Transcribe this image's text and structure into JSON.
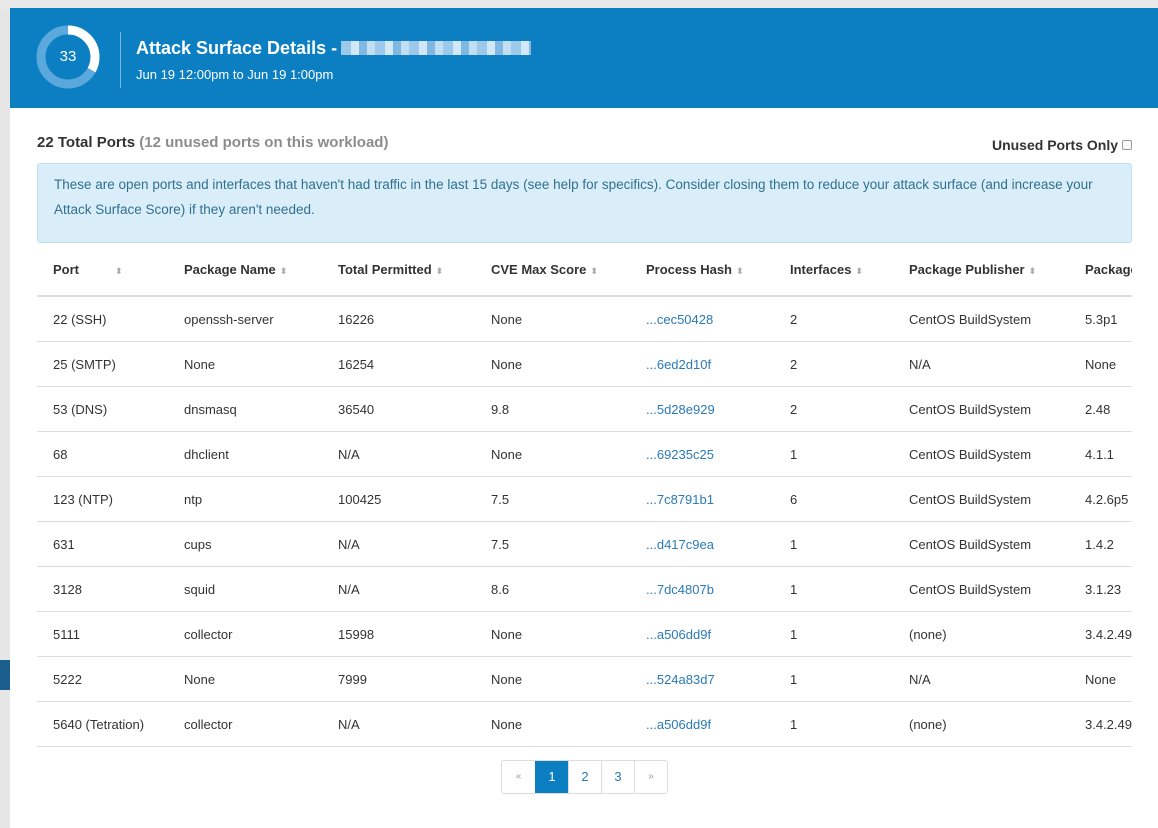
{
  "header": {
    "score": "33",
    "score_fraction": 0.33,
    "title": "Attack Surface Details -",
    "time_range": "Jun 19 12:00pm to Jun 19 1:00pm"
  },
  "summary": {
    "total_ports": "22 Total Ports",
    "unused_note": "(12 unused ports on this workload)",
    "unused_only_label": "Unused Ports Only",
    "unused_only_checked": false
  },
  "info_message": "These are open ports and interfaces that haven't had traffic in the last 15 days (see help for specifics). Consider closing them to reduce your attack surface (and increase your Attack Surface Score) if they aren't needed.",
  "table": {
    "columns": [
      "Port",
      "Package Name",
      "Total Permitted",
      "CVE Max Score",
      "Process Hash",
      "Interfaces",
      "Package Publisher",
      "Package Version"
    ],
    "rows": [
      [
        "22 (SSH)",
        "openssh-server",
        "16226",
        "None",
        "...cec50428",
        "2",
        "CentOS BuildSystem",
        "5.3p1"
      ],
      [
        "25 (SMTP)",
        "None",
        "16254",
        "None",
        "...6ed2d10f",
        "2",
        "N/A",
        "None"
      ],
      [
        "53 (DNS)",
        "dnsmasq",
        "36540",
        "9.8",
        "...5d28e929",
        "2",
        "CentOS BuildSystem",
        "2.48"
      ],
      [
        "68",
        "dhclient",
        "N/A",
        "None",
        "...69235c25",
        "1",
        "CentOS BuildSystem",
        "4.1.1"
      ],
      [
        "123 (NTP)",
        "ntp",
        "100425",
        "7.5",
        "...7c8791b1",
        "6",
        "CentOS BuildSystem",
        "4.2.6p5"
      ],
      [
        "631",
        "cups",
        "N/A",
        "7.5",
        "...d417c9ea",
        "1",
        "CentOS BuildSystem",
        "1.4.2"
      ],
      [
        "3128",
        "squid",
        "N/A",
        "8.6",
        "...7dc4807b",
        "1",
        "CentOS BuildSystem",
        "3.1.23"
      ],
      [
        "5111",
        "collector",
        "15998",
        "None",
        "...a506dd9f",
        "1",
        "(none)",
        "3.4.2.49"
      ],
      [
        "5222",
        "None",
        "7999",
        "None",
        "...524a83d7",
        "1",
        "N/A",
        "None"
      ],
      [
        "5640 (Tetration)",
        "collector",
        "N/A",
        "None",
        "...a506dd9f",
        "1",
        "(none)",
        "3.4.2.49"
      ]
    ]
  },
  "pagination": {
    "prev": "«",
    "pages": [
      "1",
      "2",
      "3"
    ],
    "active_page": "1",
    "next": "»"
  },
  "colors": {
    "header_bg": "#0c7fc3",
    "info_bg": "#d9eef8",
    "info_text": "#31708f",
    "link": "#2a7ab8"
  }
}
